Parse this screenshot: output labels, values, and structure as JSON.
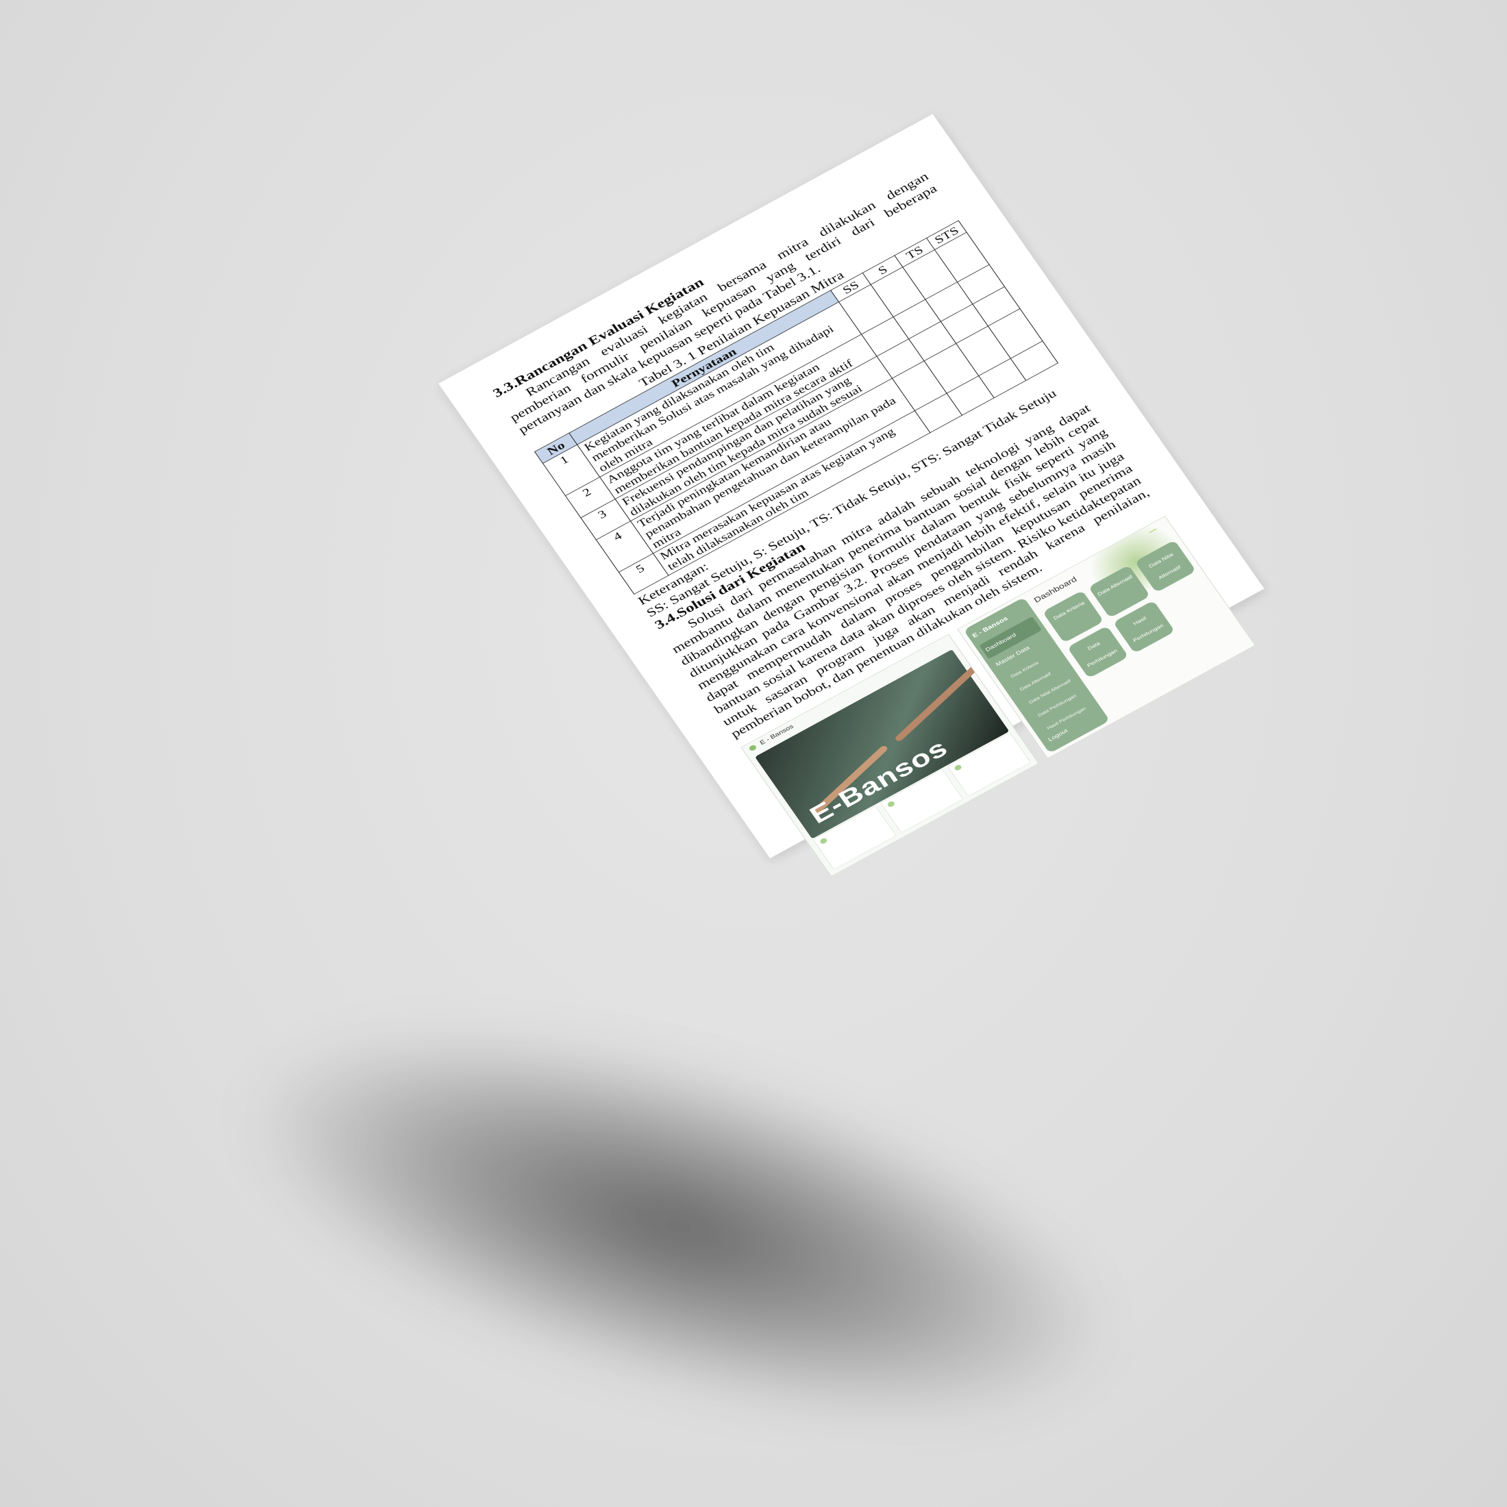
{
  "section_33": {
    "title": "3.3.Rancangan Evaluasi Kegiatan",
    "paragraph": "Rancangan evaluasi kegiatan bersama mitra dilakukan dengan pemberian formulir penilaian kepuasan yang terdiri dari beberapa pertanyaan dan skala kepuasan seperti pada Tabel 3.1."
  },
  "table_caption": "Tabel 3. 1 Penilaian Kepuasan Mitra",
  "table": {
    "headers": [
      "No",
      "Pernyataan",
      "SS",
      "S",
      "TS",
      "STS"
    ],
    "rows": [
      {
        "no": "1",
        "text": "Kegiatan yang dilaksanakan oleh tim memberikan Solusi atas masalah yang dihadapi oleh mitra"
      },
      {
        "no": "2",
        "text": "Anggota tim yang terlibat dalam kegiatan memberikan bantuan kepada mitra secara aktif"
      },
      {
        "no": "3",
        "text": "Frekuensi pendampingan dan pelatihan yang dilakukan oleh tim kepada mitra sudah sesuai"
      },
      {
        "no": "4",
        "text": "Terjadi peningkatan kemandirian atau penambahan pengetahuan dan keterampilan pada mitra"
      },
      {
        "no": "5",
        "text": "Mitra merasakan kepuasan atas kegiatan yang telah dilaksanakan oleh tim"
      }
    ]
  },
  "legend_label": "Keterangan:",
  "legend_text": "SS: Sangat Setuju, S: Setuju, TS: Tidak Setuju, STS: Sangat Tidak Setuju",
  "section_34": {
    "title": "3.4.Solusi dari Kegiatan",
    "paragraph": "Solusi dari permasalahan mitra adalah sebuah teknologi yang dapat membantu dalam menentukan penerima bantuan sosial dengan lebih cepat dibandingkan dengan pengisian formulir dalam bentuk fisik seperti yang ditunjukkan pada Gambar 3.2. Proses pendataan yang sebelumnya masih menggunakan cara konvensional akan menjadi lebih efektif, selain itu juga dapat mempermudah dalam proses pengambilan keputusan penerima bantuan sosial karena data akan diproses oleh sistem. Risiko ketidaktepatan untuk sasaran program juga akan menjadi rendah karena penilaian, pemberian bobot, dan penentuan dilakukan oleh sistem."
  },
  "figure_landing": {
    "brand": "E - Bansos",
    "hero_title": "E-Bansos"
  },
  "figure_dashboard": {
    "brand": "E - Bansos",
    "heading": "Dashboard",
    "menu": [
      "Dashboard",
      "Master Data"
    ],
    "logout": "Logout",
    "tiles": [
      "Data Kriteria",
      "Data Alternatif",
      "Data Nilai Alternatif",
      "Data Perhitungan",
      "Hasil Perhitungan"
    ]
  },
  "colors": {
    "table_header": "#c6d5ea",
    "dashboard_green": "#8fb08f",
    "accent_lime": "#c2df7a"
  }
}
